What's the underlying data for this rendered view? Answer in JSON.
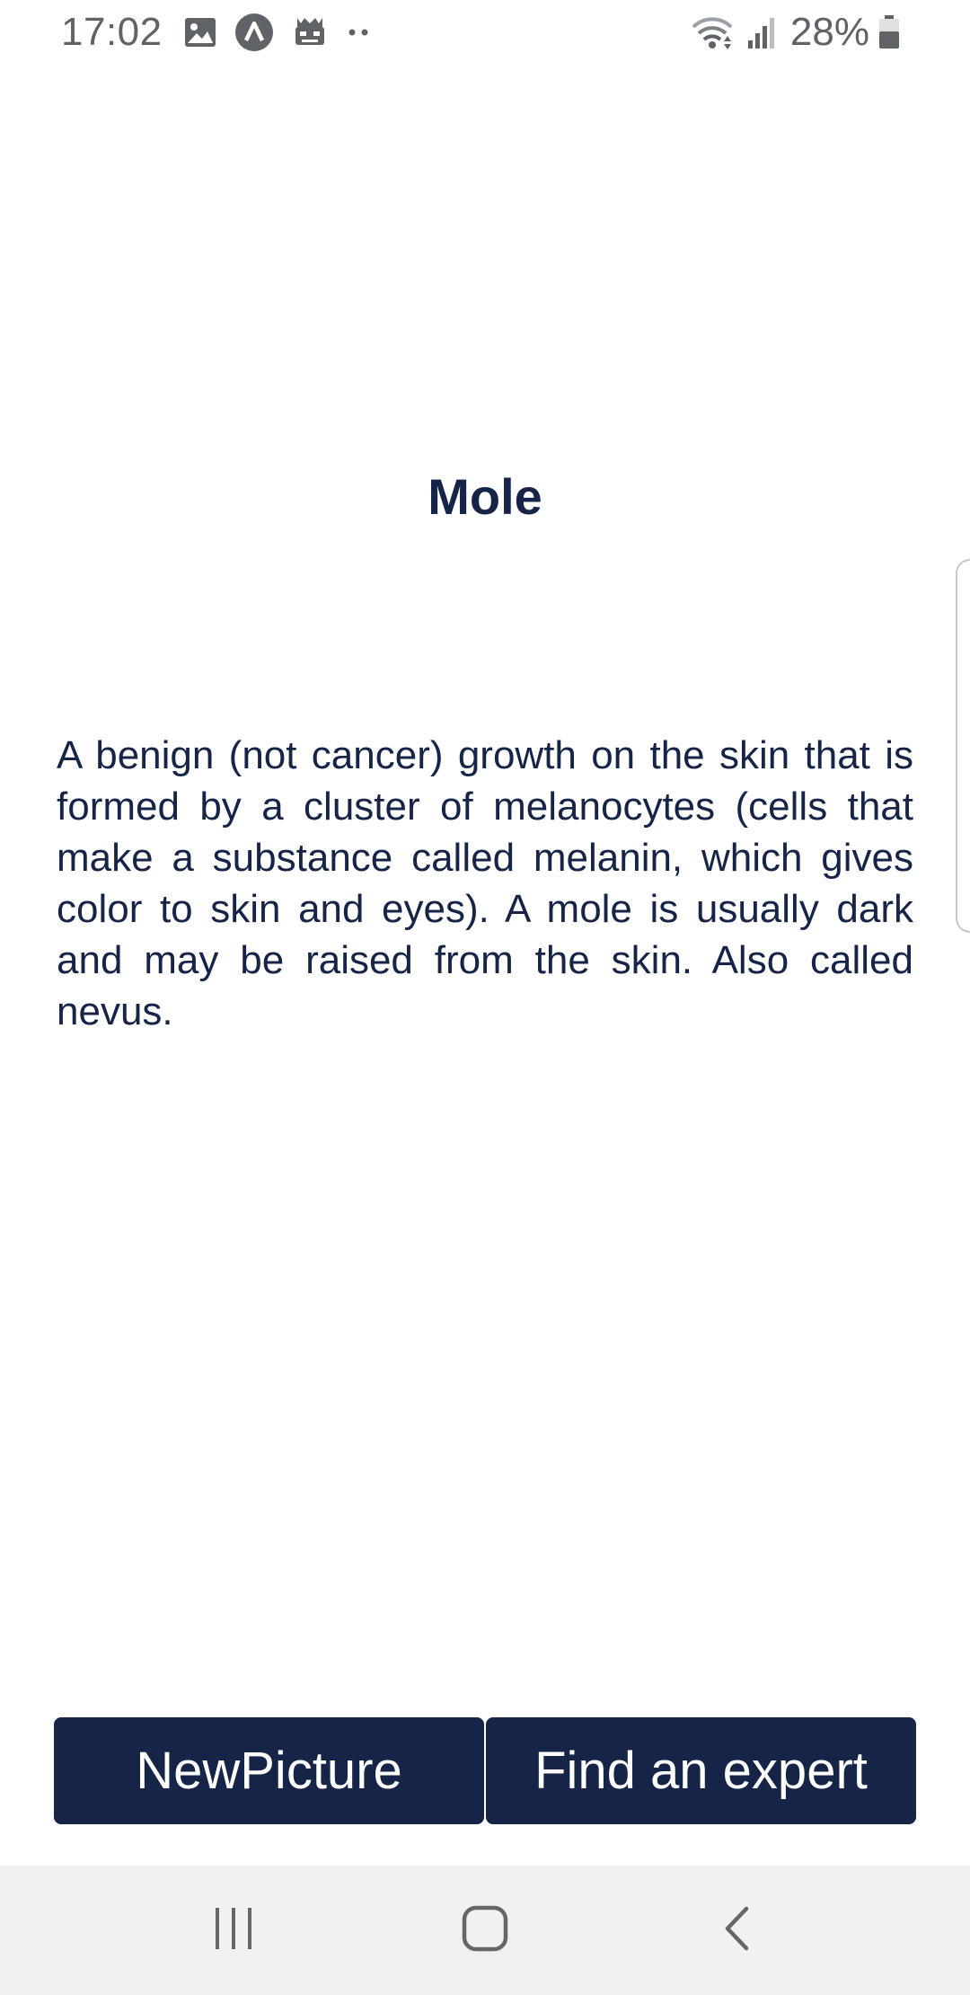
{
  "status_bar": {
    "time": "17:02",
    "notification_icons": [
      "image-icon",
      "app-a-icon",
      "robot-icon",
      "more-dots-icon"
    ],
    "system_icons": [
      "wifi-icon",
      "signal-icon",
      "battery-icon"
    ],
    "battery_percent": "28%"
  },
  "result": {
    "title": "Mole",
    "description": "A benign (not cancer) growth on the skin that is formed by a cluster of melanocytes (cells that make a substance called melanin, which gives color to skin and eyes). A mole is usually dark and may be raised from the skin. Also called nevus."
  },
  "actions": {
    "new_picture_label": "NewPicture",
    "find_expert_label": "Find an expert"
  },
  "nav_bar": {
    "buttons": [
      "recents-icon",
      "home-icon",
      "back-icon"
    ]
  },
  "colors": {
    "primary": "#162447",
    "background": "#ffffff",
    "nav_background": "#f1f1f1",
    "status_text": "#5f6368"
  }
}
